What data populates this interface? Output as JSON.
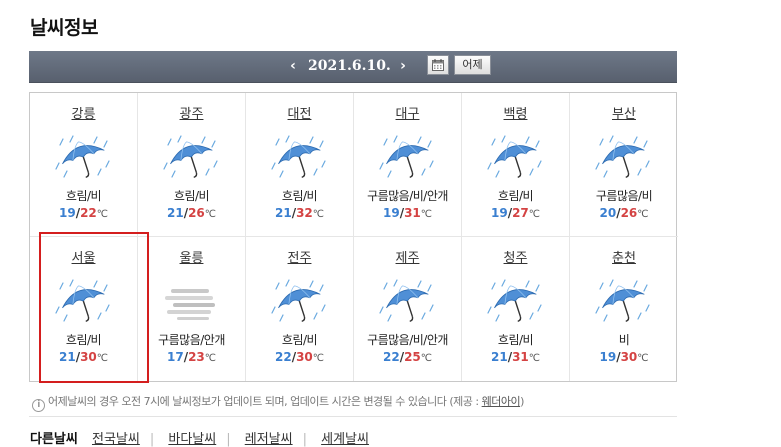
{
  "page_title": "날씨정보",
  "date_bar": {
    "date": "2021.6.10.",
    "prev_arrow": "‹",
    "next_arrow": "›",
    "yesterday_label": "어제"
  },
  "cities": [
    {
      "name": "강릉",
      "condition": "흐림/비",
      "min": "19",
      "max": "22",
      "icon": "umbrella-rain-icon"
    },
    {
      "name": "광주",
      "condition": "흐림/비",
      "min": "21",
      "max": "26",
      "icon": "umbrella-rain-icon"
    },
    {
      "name": "대전",
      "condition": "흐림/비",
      "min": "21",
      "max": "32",
      "icon": "umbrella-rain-icon"
    },
    {
      "name": "대구",
      "condition": "구름많음/비/안개",
      "min": "19",
      "max": "31",
      "icon": "umbrella-rain-icon"
    },
    {
      "name": "백령",
      "condition": "흐림/비",
      "min": "19",
      "max": "27",
      "icon": "umbrella-rain-icon"
    },
    {
      "name": "부산",
      "condition": "구름많음/비",
      "min": "20",
      "max": "26",
      "icon": "umbrella-rain-icon"
    },
    {
      "name": "서울",
      "condition": "흐림/비",
      "min": "21",
      "max": "30",
      "icon": "umbrella-rain-icon"
    },
    {
      "name": "울릉",
      "condition": "구름많음/안개",
      "min": "17",
      "max": "23",
      "icon": "fog-icon"
    },
    {
      "name": "전주",
      "condition": "흐림/비",
      "min": "22",
      "max": "30",
      "icon": "umbrella-rain-icon"
    },
    {
      "name": "제주",
      "condition": "구름많음/비/안개",
      "min": "22",
      "max": "25",
      "icon": "umbrella-rain-icon"
    },
    {
      "name": "청주",
      "condition": "흐림/비",
      "min": "21",
      "max": "31",
      "icon": "umbrella-rain-icon"
    },
    {
      "name": "춘천",
      "condition": "비",
      "min": "19",
      "max": "30",
      "icon": "umbrella-rain-icon"
    }
  ],
  "temp_separator": "/",
  "temp_unit": "℃",
  "notice": {
    "text": "어제날씨의 경우 오전 7시에 날씨정보가 업데이트 되며, 업데이트 시간은 변경될 수 있습니다 (제공 : ",
    "provider": "웨더아이",
    "suffix": ")"
  },
  "bottom_tabs": {
    "current": "다른날씨",
    "items": [
      "전국날씨",
      "바다날씨",
      "레저날씨",
      "세계날씨"
    ]
  },
  "colors": {
    "min_temp": "#3a7fd0",
    "max_temp": "#d44343",
    "highlight": "#d41e1e",
    "date_bar": "#626b7a"
  }
}
